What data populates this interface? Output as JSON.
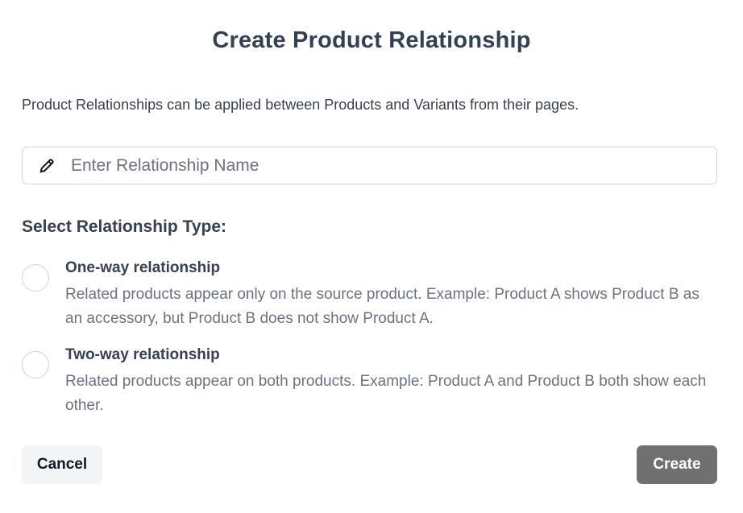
{
  "dialog": {
    "title": "Create Product Relationship",
    "description": "Product Relationships can be applied between Products and Variants from their pages.",
    "name_input": {
      "value": "",
      "placeholder": "Enter Relationship Name",
      "icon": "pencil-icon"
    },
    "type_section": {
      "label": "Select Relationship Type:",
      "options": [
        {
          "title": "One-way relationship",
          "description": "Related products appear only on the source product. Example: Product A shows Product B as an accessory, but Product B does not show Product A.",
          "selected": false
        },
        {
          "title": "Two-way relationship",
          "description": "Related products appear on both products. Example: Product A and Product B both show each other.",
          "selected": false
        }
      ]
    },
    "buttons": {
      "cancel_label": "Cancel",
      "create_label": "Create",
      "create_enabled": false
    },
    "colors": {
      "title": "#334155",
      "create_button_disabled": "#707070",
      "cancel_button_bg": "#f3f4f6",
      "muted_text": "#6b7280"
    }
  }
}
